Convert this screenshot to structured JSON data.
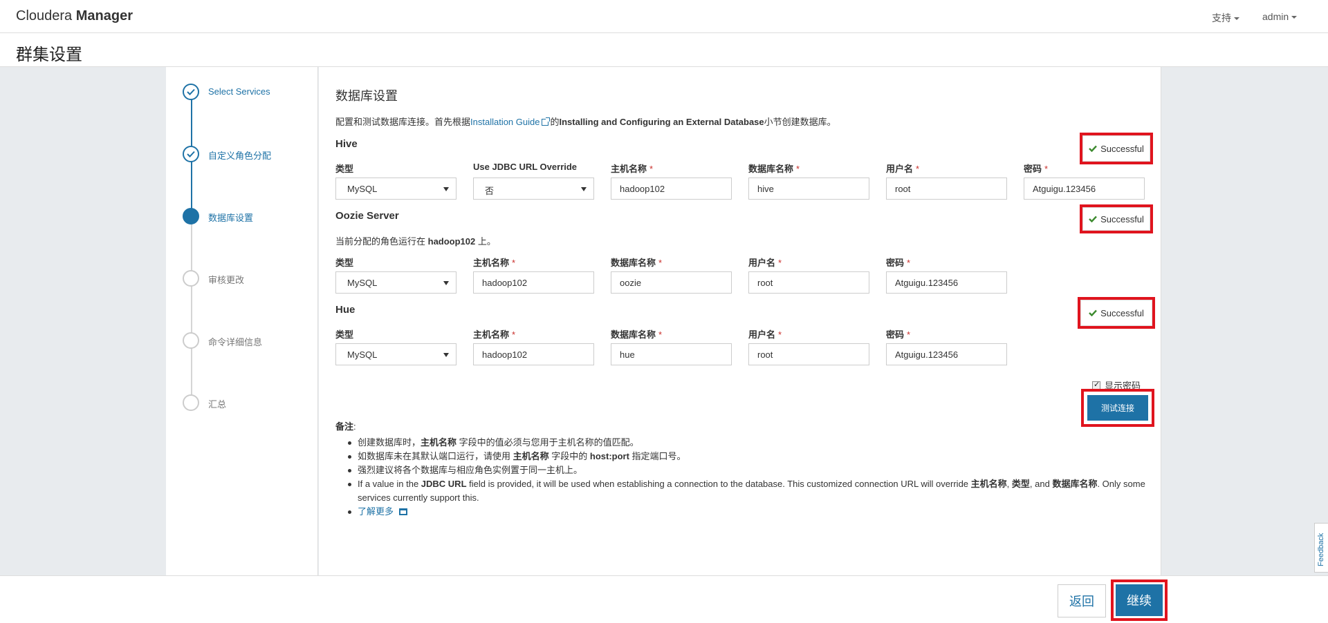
{
  "topbar": {
    "brand_light": "Cloudera",
    "brand_bold": "Manager",
    "support": "支持",
    "user": "admin"
  },
  "page_title": "群集设置",
  "steps": [
    {
      "label": "Select Services",
      "state": "done"
    },
    {
      "label": "自定义角色分配",
      "state": "done"
    },
    {
      "label": "数据库设置",
      "state": "active"
    },
    {
      "label": "审核更改",
      "state": "pending"
    },
    {
      "label": "命令详细信息",
      "state": "pending"
    },
    {
      "label": "汇总",
      "state": "pending"
    }
  ],
  "main": {
    "title": "数据库设置",
    "intro_prefix": "配置和测试数据库连接。首先根据",
    "intro_link": "Installation Guide",
    "intro_mid": "的",
    "intro_bold": "Installing and Configuring an External Database",
    "intro_suffix": "小节创建数据库。"
  },
  "labels": {
    "type": "类型",
    "jdbc_override": "Use JDBC URL Override",
    "host": "主机名称",
    "dbname": "数据库名称",
    "user": "用户名",
    "password": "密码",
    "required": "*",
    "successful": "Successful"
  },
  "hive": {
    "title": "Hive",
    "type": "MySQL",
    "jdbc_override": "否",
    "host": "hadoop102",
    "dbname": "hive",
    "user": "root",
    "password": "Atguigu.123456"
  },
  "oozie": {
    "title": "Oozie Server",
    "note_prefix": "当前分配的角色运行在 ",
    "note_host": "hadoop102",
    "note_suffix": " 上。",
    "type": "MySQL",
    "host": "hadoop102",
    "dbname": "oozie",
    "user": "root",
    "password": "Atguigu.123456"
  },
  "hue": {
    "title": "Hue",
    "type": "MySQL",
    "host": "hadoop102",
    "dbname": "hue",
    "user": "root",
    "password": "Atguigu.123456"
  },
  "show_password": "显示密码",
  "test_button": "测试连接",
  "notes": {
    "title": "备注",
    "colon": ":",
    "n1_a": "创建数据库时，",
    "n1_b": "主机名称",
    "n1_c": " 字段中的值必须与您用于主机名称的值匹配。",
    "n2_a": "如数据库未在其默认端口运行，请使用 ",
    "n2_b": "主机名称",
    "n2_c": " 字段中的 ",
    "n2_d": "host:port",
    "n2_e": " 指定端口号。",
    "n3": "强烈建议将各个数据库与相应角色实例置于同一主机上。",
    "n4_a": "If a value in the ",
    "n4_b": "JDBC URL",
    "n4_c": " field is provided, it will be used when establishing a connection to the database. This customized connection URL will override ",
    "n4_d": "主机名称",
    "n4_e": ", ",
    "n4_f": "类型",
    "n4_g": ", and ",
    "n4_h": "数据库名称",
    "n4_i": ". Only some services currently support this.",
    "learn_more": "了解更多"
  },
  "footer": {
    "back": "返回",
    "continue": "继续"
  },
  "feedback": "Feedback",
  "colors": {
    "accent": "#1e72a6",
    "highlight": "#e0141e",
    "success": "#3c8a2e"
  }
}
